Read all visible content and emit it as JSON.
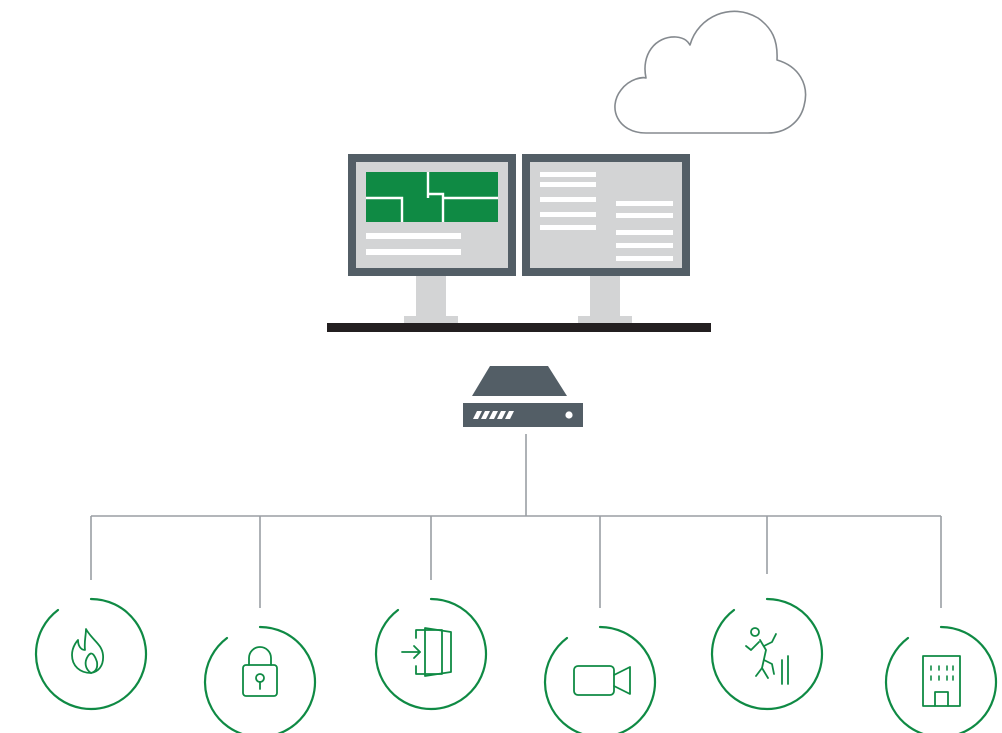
{
  "diagram": {
    "cloud": {
      "icon": "cloud-icon"
    },
    "workstation": {
      "icon": "dual-monitor-workstation-icon"
    },
    "controller": {
      "icon": "network-server-icon"
    },
    "subsystems": [
      {
        "id": "fire",
        "icon": "flame-icon"
      },
      {
        "id": "security",
        "icon": "padlock-icon"
      },
      {
        "id": "access",
        "icon": "door-entry-icon"
      },
      {
        "id": "video",
        "icon": "video-camera-icon"
      },
      {
        "id": "intrusion",
        "icon": "intruder-icon"
      },
      {
        "id": "building",
        "icon": "building-icon"
      }
    ]
  },
  "colors": {
    "accent_green": "#0f8a44",
    "line_gray": "#9a9ea3",
    "device_dark": "#535e66",
    "screen_light": "#d3d4d5",
    "desk_black": "#231f20",
    "cloud_outline": "#858a8f"
  }
}
